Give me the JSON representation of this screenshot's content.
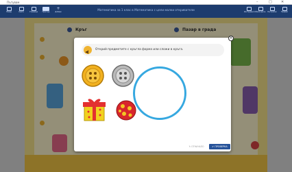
{
  "window": {
    "title": "Пътувам",
    "minimize": "–",
    "maximize": "□",
    "close": "✕"
  },
  "toolbar": {
    "left_tools": [
      {
        "icon": "back-icon",
        "label": "Назад"
      },
      {
        "icon": "book-icon",
        "label": "Книга"
      },
      {
        "icon": "page-icon",
        "label": "Страница"
      },
      {
        "icon": "grid-icon",
        "label": "Преглед"
      },
      {
        "icon": "add-icon",
        "label": "Добави"
      }
    ],
    "heading": "Математика за 1 клас в Математика с цели малки откриватели",
    "right_tools": [
      {
        "icon": "tools-icon",
        "label": "Инструменти"
      },
      {
        "icon": "board-icon",
        "label": "Бяла дъска"
      },
      {
        "icon": "settings-icon",
        "label": "Настройки"
      },
      {
        "icon": "user-icon",
        "label": "Профил"
      }
    ]
  },
  "page": {
    "left_title": "Кръг",
    "right_title": "Пазар в града"
  },
  "modal": {
    "task": "Открий предметите с кръгла форма или сложи в кръга.",
    "reset_label": "↻ ОТНАЧАЛО",
    "check_label": "✔ ПРОВЕРКА",
    "close_label": "×",
    "items": [
      {
        "name": "yellow-button",
        "color": "#f2b11f"
      },
      {
        "name": "gray-button",
        "color": "#b9b9b9"
      },
      {
        "name": "gift-box",
        "color": "#e33030"
      },
      {
        "name": "red-ball",
        "color": "#d8262b"
      }
    ],
    "target_color": "#36a8e0"
  }
}
